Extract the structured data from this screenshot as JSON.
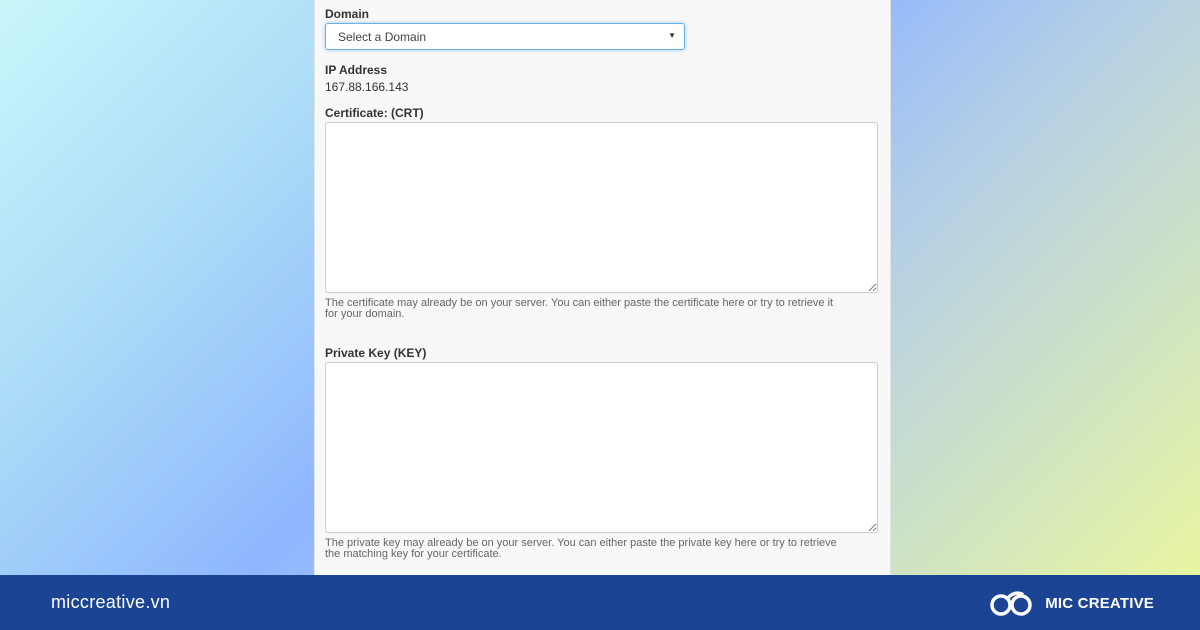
{
  "form": {
    "domain_label": "Domain",
    "domain_select_value": "Select a Domain",
    "ip_label": "IP Address",
    "ip_value": "167.88.166.143",
    "crt_label": "Certificate: (CRT)",
    "crt_value": "",
    "crt_help_line1": "The certificate may already be on your server. You can either paste the certificate here or try to retrieve it",
    "crt_help_line2": "for your domain.",
    "key_label": "Private Key (KEY)",
    "key_value": "",
    "key_help_line1": "The private key may already be on your server. You can either paste the private key here or try to retrieve",
    "key_help_line2": "the matching key for your certificate."
  },
  "footer": {
    "site": "miccreative.vn",
    "brand_name": "MIC CREATIVE",
    "brand_icon": "infinity-logo-icon"
  },
  "colors": {
    "footer_bg": "#1c4494",
    "focus_border": "#66afe9"
  }
}
